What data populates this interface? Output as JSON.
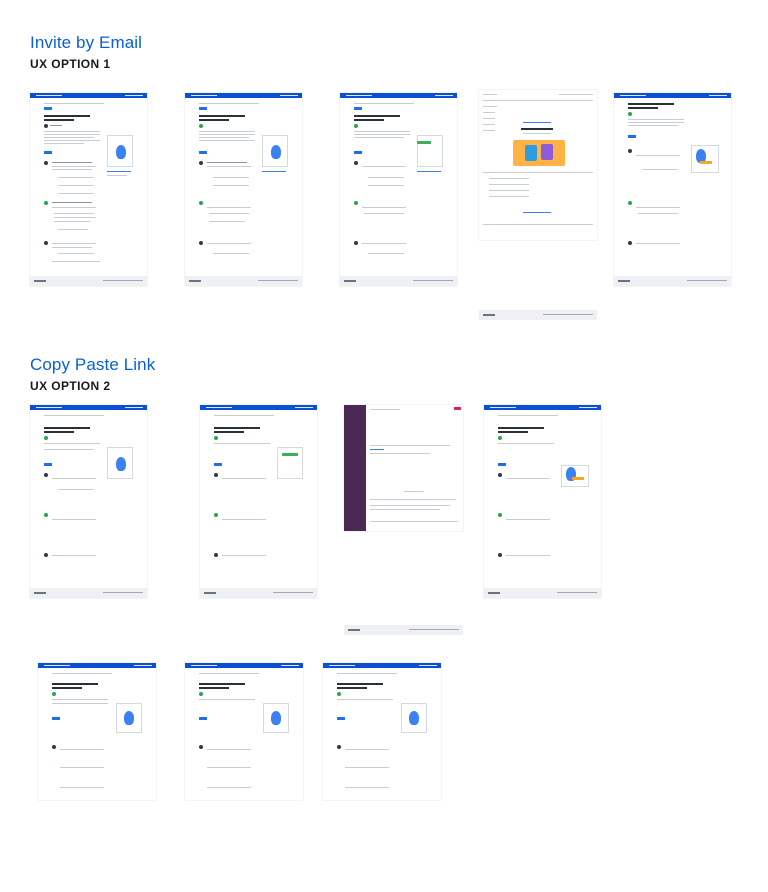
{
  "sections": {
    "invite": {
      "title": "Invite by Email",
      "subtitle": "UX OPTION 1"
    },
    "copy": {
      "title": "Copy Paste Link",
      "subtitle": "UX OPTION 2"
    }
  },
  "colors": {
    "accent": "#0a5fd6",
    "nav": "#0b4fd4",
    "slack": "#4a2a55"
  }
}
